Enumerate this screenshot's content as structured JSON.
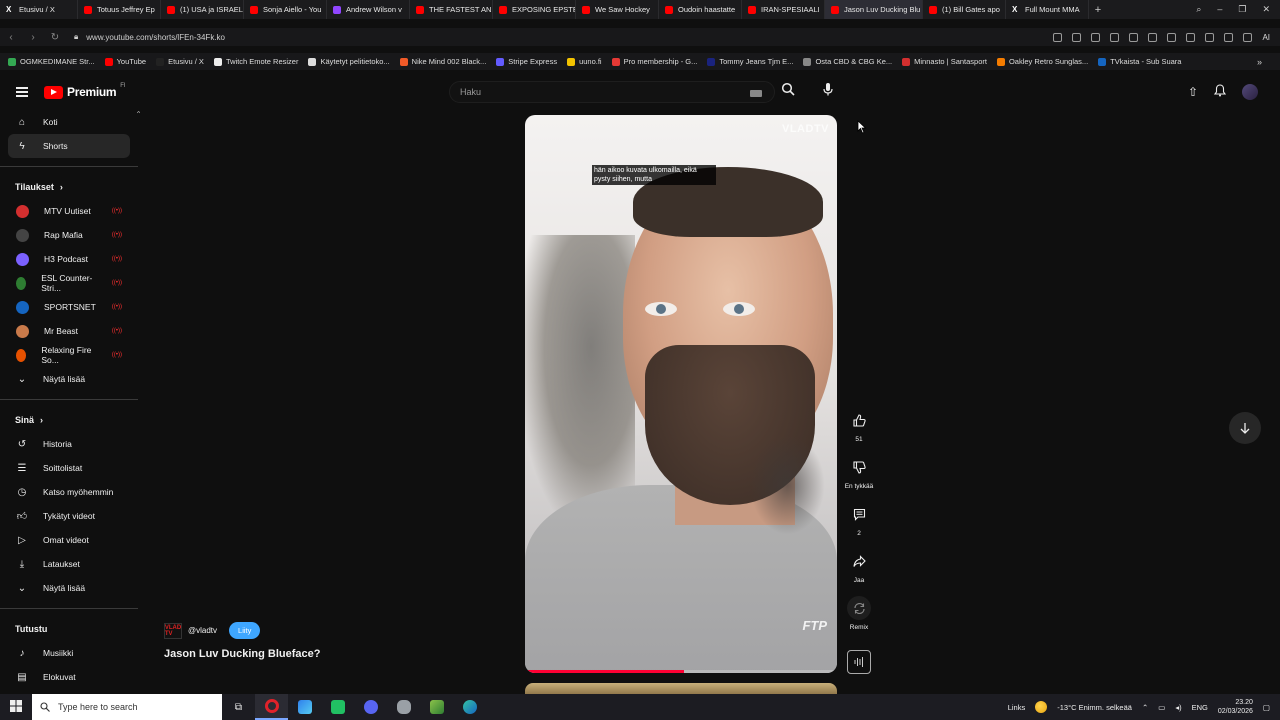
{
  "browser": {
    "tabs": [
      {
        "label": "Etusivu / X",
        "icon": "x-icon",
        "color": "#000000"
      },
      {
        "label": "Totuus Jeffrey Ep",
        "icon": "youtube-icon",
        "color": "#ff0000"
      },
      {
        "label": "(1) USA ja ISRAEL",
        "icon": "youtube-icon",
        "color": "#ff0000"
      },
      {
        "label": "Sonja Aiello - You",
        "icon": "youtube-icon",
        "color": "#ff0000"
      },
      {
        "label": "Andrew Wilson v",
        "icon": "twitch-icon",
        "color": "#9146ff"
      },
      {
        "label": "THE FASTEST AN",
        "icon": "youtube-icon",
        "color": "#ff0000"
      },
      {
        "label": "EXPOSING EPSTE",
        "icon": "youtube-icon",
        "color": "#ff0000"
      },
      {
        "label": "We Saw Hockey",
        "icon": "youtube-icon",
        "color": "#ff0000"
      },
      {
        "label": "Oudoin haastatte",
        "icon": "youtube-icon",
        "color": "#ff0000"
      },
      {
        "label": "IRAN-SPESIAALI",
        "icon": "youtube-icon",
        "color": "#ff0000"
      },
      {
        "label": "Jason Luv Ducking Blu",
        "icon": "youtube-icon",
        "color": "#ff0000",
        "active": true
      },
      {
        "label": "(1) Bill Gates apo",
        "icon": "youtube-icon",
        "color": "#ff0000"
      },
      {
        "label": "Full Mount MMA",
        "icon": "x-icon",
        "color": "#000000"
      }
    ],
    "url": "www.youtube.com/shorts/lFEn-34Fk.ko",
    "ai_label": "AI",
    "bookmarks": [
      {
        "label": "OGMKEDIMANE Str...",
        "color": "#34a853"
      },
      {
        "label": "YouTube",
        "color": "#ff0000"
      },
      {
        "label": "Etusivu / X",
        "color": "#222222"
      },
      {
        "label": "Twitch Emote Resizer",
        "color": "#eeeeee"
      },
      {
        "label": "Käytetyt pelitietoko...",
        "color": "#dddddd"
      },
      {
        "label": "Nike Mind 002 Black...",
        "color": "#f05a28"
      },
      {
        "label": "Stripe Express",
        "color": "#635bff"
      },
      {
        "label": "uuno.fi",
        "color": "#f3c300"
      },
      {
        "label": "Pro membership - G...",
        "color": "#e53935"
      },
      {
        "label": "Tommy Jeans Tjm E...",
        "color": "#1a237e"
      },
      {
        "label": "Osta CBD & CBG Ke...",
        "color": "#888888"
      },
      {
        "label": "Minnasto | Santasport",
        "color": "#d32f2f"
      },
      {
        "label": "Oakley Retro Sunglas...",
        "color": "#f57c00"
      },
      {
        "label": "TVkaista - Sub Suara",
        "color": "#1565c0"
      }
    ]
  },
  "youtube": {
    "logo_text": "Premium",
    "logo_country": "FI",
    "search_placeholder": "Haku"
  },
  "sidebar": {
    "nav": [
      {
        "label": "Koti",
        "icon": "home-icon"
      },
      {
        "label": "Shorts",
        "icon": "shorts-icon",
        "active": true
      }
    ],
    "subscriptions_title": "Tilaukset",
    "subscriptions": [
      {
        "label": "MTV Uutiset",
        "color": "#d32f2f"
      },
      {
        "label": "Rap Mafia",
        "color": "#444444"
      },
      {
        "label": "H3 Podcast",
        "color": "#7b61ff"
      },
      {
        "label": "ESL Counter-Stri...",
        "color": "#2e7d32"
      },
      {
        "label": "SPORTSNET",
        "color": "#1565c0"
      },
      {
        "label": "Mr Beast",
        "color": "#c97a4a"
      },
      {
        "label": "Relaxing Fire So...",
        "color": "#e65100"
      }
    ],
    "show_more": "Näytä lisää",
    "you_title": "Sinä",
    "you_items": [
      {
        "label": "Historia",
        "icon": "history-icon"
      },
      {
        "label": "Soittolistat",
        "icon": "playlists-icon"
      },
      {
        "label": "Katso myöhemmin",
        "icon": "watch-later-icon"
      },
      {
        "label": "Tykätyt videot",
        "icon": "liked-icon"
      },
      {
        "label": "Omat videot",
        "icon": "your-videos-icon"
      },
      {
        "label": "Lataukset",
        "icon": "downloads-icon"
      },
      {
        "label": "Näytä lisää",
        "icon": "chevron-down-icon"
      }
    ],
    "explore_title": "Tutustu",
    "explore_items": [
      {
        "label": "Musiikki",
        "icon": "music-icon"
      },
      {
        "label": "Elokuvat",
        "icon": "movies-icon"
      }
    ]
  },
  "video": {
    "watermark": "VLADTV",
    "corner_logo": "FTP",
    "caption": "hän aikoo kuvata ulkomailla, eikä pysty siihen, mutta",
    "progress_fraction": 0.51,
    "channel_logo_text": "VLAD TV",
    "channel_handle": "@vladtv",
    "join_label": "Liity",
    "title": "Jason Luv Ducking Blueface?"
  },
  "actions": {
    "like_count": "51",
    "dislike_label": "En tykkää",
    "comments_count": "2",
    "share_label": "Jaa",
    "remix_label": "Remix"
  },
  "taskbar": {
    "search_placeholder": "Type here to search",
    "links_label": "Links",
    "weather": "-13°C  Enimm. selkeää",
    "language": "ENG",
    "time": "23.20",
    "date": "02/03/2026"
  }
}
